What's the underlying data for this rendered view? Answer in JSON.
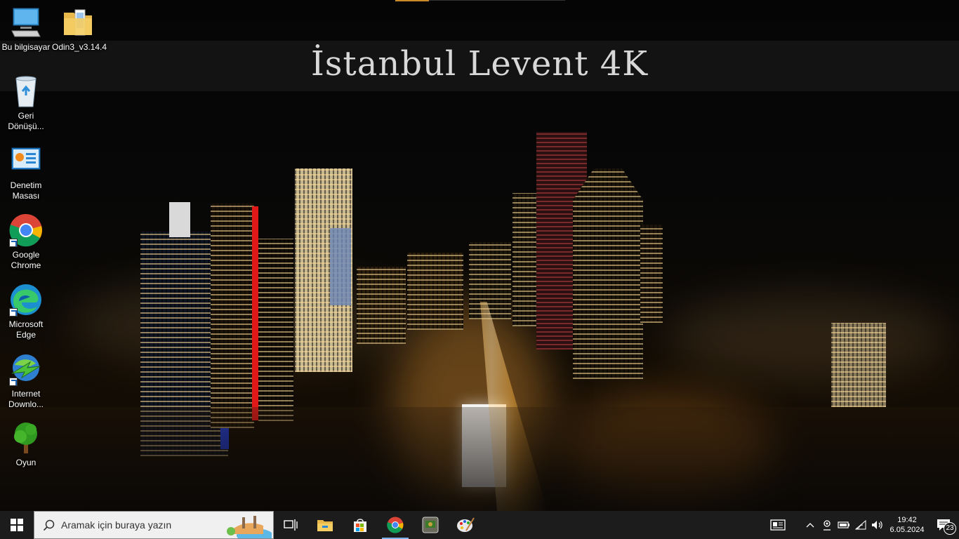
{
  "wallpaper": {
    "title": "İstanbul Levent 4K"
  },
  "desktop_icons": [
    {
      "label": "Bu bilgisayar",
      "icon": "computer-icon"
    },
    {
      "label": "Odin3_v3.14.4",
      "icon": "folder-icon"
    },
    {
      "label": "Geri Dönüşü...",
      "icon": "recycle-bin-icon"
    },
    {
      "label": "Denetim Masası",
      "icon": "control-panel-icon"
    },
    {
      "label": "Google Chrome",
      "icon": "chrome-icon"
    },
    {
      "label": "Microsoft Edge",
      "icon": "edge-icon"
    },
    {
      "label": "Internet Downlo...",
      "icon": "internet-download-manager-icon"
    },
    {
      "label": "Oyun",
      "icon": "tree-icon"
    }
  ],
  "taskbar": {
    "search_placeholder": "Aramak için buraya yazın",
    "clock_time": "19:42",
    "clock_date": "6.05.2024",
    "notification_count": "23"
  },
  "colors": {
    "taskbar_bg": "#1c1c1c",
    "accent": "#7fb2e8"
  }
}
